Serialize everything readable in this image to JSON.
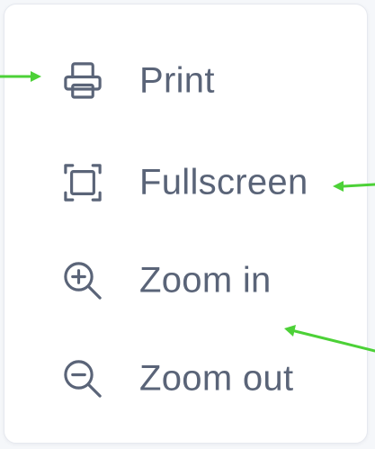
{
  "menu": {
    "items": [
      {
        "label": "Print",
        "icon": "printer-icon"
      },
      {
        "label": "Fullscreen",
        "icon": "fullscreen-icon"
      },
      {
        "label": "Zoom in",
        "icon": "zoom-in-icon"
      },
      {
        "label": "Zoom out",
        "icon": "zoom-out-icon"
      }
    ]
  },
  "colors": {
    "text": "#5a6478",
    "icon": "#5a6478",
    "annotation_arrow": "#4cd137",
    "card_border": "#e6e9ef"
  }
}
